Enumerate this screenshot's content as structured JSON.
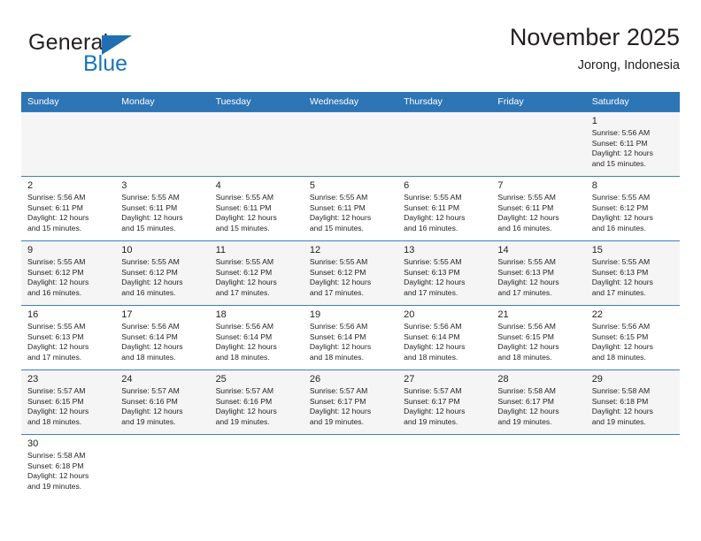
{
  "brand": {
    "name_part1": "General",
    "name_part2": "Blue",
    "triangle_color": "#1f6fb2",
    "blue_color": "#1b75bb"
  },
  "header": {
    "title": "November 2025",
    "subtitle": "Jorong, Indonesia"
  },
  "theme": {
    "header_bg": "#2e75b6",
    "header_text": "#ffffff",
    "shaded_row_bg": "#f5f5f5",
    "grid_line": "#3d7fc1",
    "text": "#231f20"
  },
  "weekdays": [
    "Sunday",
    "Monday",
    "Tuesday",
    "Wednesday",
    "Thursday",
    "Friday",
    "Saturday"
  ],
  "weeks": [
    [
      {
        "day": "",
        "detail": ""
      },
      {
        "day": "",
        "detail": ""
      },
      {
        "day": "",
        "detail": ""
      },
      {
        "day": "",
        "detail": ""
      },
      {
        "day": "",
        "detail": ""
      },
      {
        "day": "",
        "detail": ""
      },
      {
        "day": "1",
        "detail": "Sunrise: 5:56 AM\nSunset: 6:11 PM\nDaylight: 12 hours\nand 15 minutes."
      }
    ],
    [
      {
        "day": "2",
        "detail": "Sunrise: 5:56 AM\nSunset: 6:11 PM\nDaylight: 12 hours\nand 15 minutes."
      },
      {
        "day": "3",
        "detail": "Sunrise: 5:55 AM\nSunset: 6:11 PM\nDaylight: 12 hours\nand 15 minutes."
      },
      {
        "day": "4",
        "detail": "Sunrise: 5:55 AM\nSunset: 6:11 PM\nDaylight: 12 hours\nand 15 minutes."
      },
      {
        "day": "5",
        "detail": "Sunrise: 5:55 AM\nSunset: 6:11 PM\nDaylight: 12 hours\nand 15 minutes."
      },
      {
        "day": "6",
        "detail": "Sunrise: 5:55 AM\nSunset: 6:11 PM\nDaylight: 12 hours\nand 16 minutes."
      },
      {
        "day": "7",
        "detail": "Sunrise: 5:55 AM\nSunset: 6:11 PM\nDaylight: 12 hours\nand 16 minutes."
      },
      {
        "day": "8",
        "detail": "Sunrise: 5:55 AM\nSunset: 6:12 PM\nDaylight: 12 hours\nand 16 minutes."
      }
    ],
    [
      {
        "day": "9",
        "detail": "Sunrise: 5:55 AM\nSunset: 6:12 PM\nDaylight: 12 hours\nand 16 minutes."
      },
      {
        "day": "10",
        "detail": "Sunrise: 5:55 AM\nSunset: 6:12 PM\nDaylight: 12 hours\nand 16 minutes."
      },
      {
        "day": "11",
        "detail": "Sunrise: 5:55 AM\nSunset: 6:12 PM\nDaylight: 12 hours\nand 17 minutes."
      },
      {
        "day": "12",
        "detail": "Sunrise: 5:55 AM\nSunset: 6:12 PM\nDaylight: 12 hours\nand 17 minutes."
      },
      {
        "day": "13",
        "detail": "Sunrise: 5:55 AM\nSunset: 6:13 PM\nDaylight: 12 hours\nand 17 minutes."
      },
      {
        "day": "14",
        "detail": "Sunrise: 5:55 AM\nSunset: 6:13 PM\nDaylight: 12 hours\nand 17 minutes."
      },
      {
        "day": "15",
        "detail": "Sunrise: 5:55 AM\nSunset: 6:13 PM\nDaylight: 12 hours\nand 17 minutes."
      }
    ],
    [
      {
        "day": "16",
        "detail": "Sunrise: 5:55 AM\nSunset: 6:13 PM\nDaylight: 12 hours\nand 17 minutes."
      },
      {
        "day": "17",
        "detail": "Sunrise: 5:56 AM\nSunset: 6:14 PM\nDaylight: 12 hours\nand 18 minutes."
      },
      {
        "day": "18",
        "detail": "Sunrise: 5:56 AM\nSunset: 6:14 PM\nDaylight: 12 hours\nand 18 minutes."
      },
      {
        "day": "19",
        "detail": "Sunrise: 5:56 AM\nSunset: 6:14 PM\nDaylight: 12 hours\nand 18 minutes."
      },
      {
        "day": "20",
        "detail": "Sunrise: 5:56 AM\nSunset: 6:14 PM\nDaylight: 12 hours\nand 18 minutes."
      },
      {
        "day": "21",
        "detail": "Sunrise: 5:56 AM\nSunset: 6:15 PM\nDaylight: 12 hours\nand 18 minutes."
      },
      {
        "day": "22",
        "detail": "Sunrise: 5:56 AM\nSunset: 6:15 PM\nDaylight: 12 hours\nand 18 minutes."
      }
    ],
    [
      {
        "day": "23",
        "detail": "Sunrise: 5:57 AM\nSunset: 6:15 PM\nDaylight: 12 hours\nand 18 minutes."
      },
      {
        "day": "24",
        "detail": "Sunrise: 5:57 AM\nSunset: 6:16 PM\nDaylight: 12 hours\nand 19 minutes."
      },
      {
        "day": "25",
        "detail": "Sunrise: 5:57 AM\nSunset: 6:16 PM\nDaylight: 12 hours\nand 19 minutes."
      },
      {
        "day": "26",
        "detail": "Sunrise: 5:57 AM\nSunset: 6:17 PM\nDaylight: 12 hours\nand 19 minutes."
      },
      {
        "day": "27",
        "detail": "Sunrise: 5:57 AM\nSunset: 6:17 PM\nDaylight: 12 hours\nand 19 minutes."
      },
      {
        "day": "28",
        "detail": "Sunrise: 5:58 AM\nSunset: 6:17 PM\nDaylight: 12 hours\nand 19 minutes."
      },
      {
        "day": "29",
        "detail": "Sunrise: 5:58 AM\nSunset: 6:18 PM\nDaylight: 12 hours\nand 19 minutes."
      }
    ],
    [
      {
        "day": "30",
        "detail": "Sunrise: 5:58 AM\nSunset: 6:18 PM\nDaylight: 12 hours\nand 19 minutes."
      },
      {
        "day": "",
        "detail": ""
      },
      {
        "day": "",
        "detail": ""
      },
      {
        "day": "",
        "detail": ""
      },
      {
        "day": "",
        "detail": ""
      },
      {
        "day": "",
        "detail": ""
      },
      {
        "day": "",
        "detail": ""
      }
    ]
  ]
}
